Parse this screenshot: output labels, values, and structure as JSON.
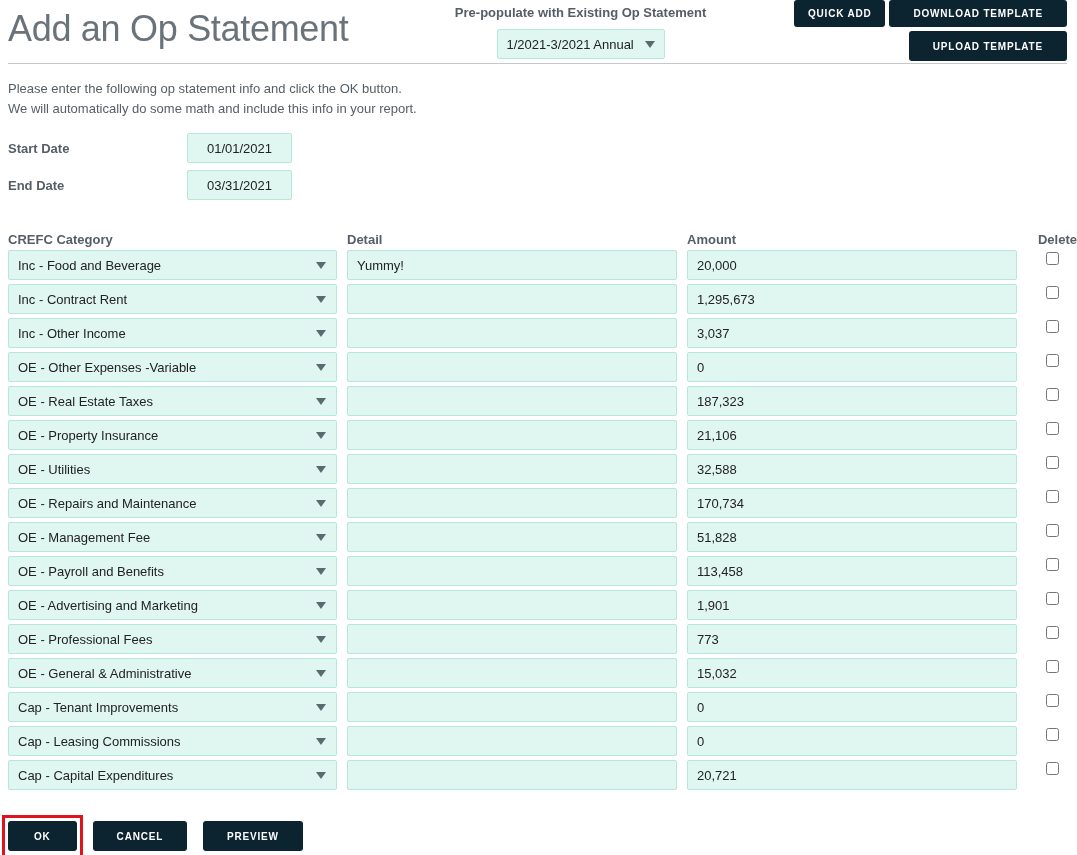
{
  "title": "Add an Op Statement",
  "prepopulate": {
    "label": "Pre-populate with Existing Op Statement",
    "value": "1/2021-3/2021 Annual"
  },
  "top_buttons": [
    {
      "label": "QUICK ADD"
    },
    {
      "label": "DOWNLOAD TEMPLATE"
    },
    {
      "label": "UPLOAD TEMPLATE"
    }
  ],
  "intro": [
    "Please enter the following op statement info and click the OK button.",
    "We will automatically do some math and include this info in your report."
  ],
  "dates": [
    {
      "label": "Start Date",
      "value": "01/01/2021"
    },
    {
      "label": "End Date",
      "value": "03/31/2021"
    }
  ],
  "table": {
    "columns": [
      "CREFC Category",
      "Detail",
      "Amount",
      "Delete"
    ],
    "rows": [
      {
        "category": "Inc - Food and Beverage",
        "detail": "Yummy!",
        "amount": "20,000",
        "delete": false
      },
      {
        "category": "Inc - Contract Rent",
        "amount": "1,295,673",
        "delete": false
      },
      {
        "category": "Inc - Other Income",
        "amount": "3,037",
        "delete": false
      },
      {
        "category": "OE - Other Expenses -Variable",
        "amount": "0",
        "delete": false
      },
      {
        "category": "OE - Real Estate Taxes",
        "amount": "187,323",
        "delete": false
      },
      {
        "category": "OE - Property Insurance",
        "amount": "21,106",
        "delete": false
      },
      {
        "category": "OE - Utilities",
        "amount": "32,588",
        "delete": false
      },
      {
        "category": "OE - Repairs and Maintenance",
        "amount": "170,734",
        "delete": false
      },
      {
        "category": "OE - Management Fee",
        "amount": "51,828",
        "delete": false
      },
      {
        "category": "OE - Payroll and Benefits",
        "amount": "113,458",
        "delete": false
      },
      {
        "category": "OE - Advertising and Marketing",
        "amount": "1,901",
        "delete": false
      },
      {
        "category": "OE - Professional Fees",
        "amount": "773",
        "delete": false
      },
      {
        "category": "OE - General & Administrative",
        "amount": "15,032",
        "delete": false
      },
      {
        "category": "Cap - Tenant Improvements",
        "amount": "0",
        "delete": false
      },
      {
        "category": "Cap - Leasing Commissions",
        "amount": "0",
        "delete": false
      },
      {
        "category": "Cap - Capital Expenditures",
        "amount": "20,721",
        "delete": false
      }
    ]
  },
  "footer_buttons": [
    {
      "label": "OK",
      "highlighted": true
    },
    {
      "label": "CANCEL",
      "highlighted": false
    },
    {
      "label": "PREVIEW",
      "highlighted": false
    }
  ]
}
